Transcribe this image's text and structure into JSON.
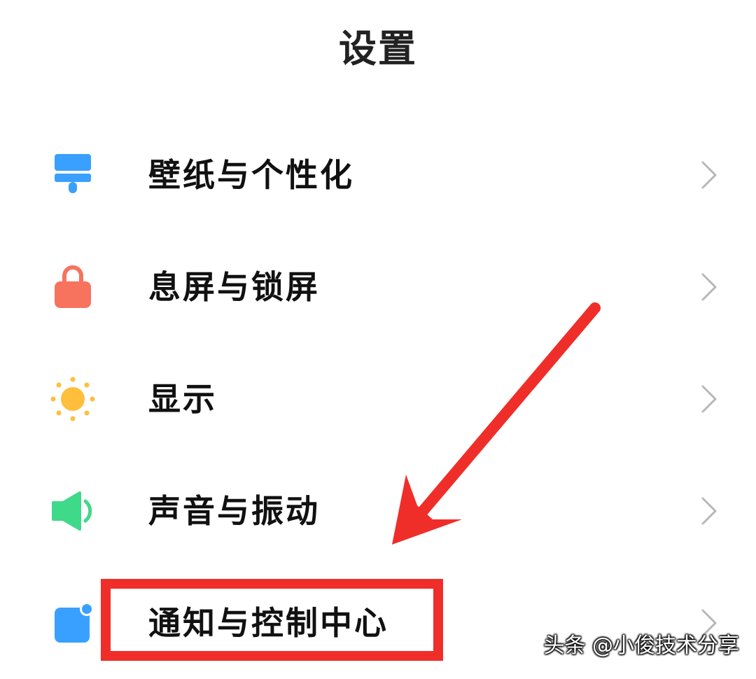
{
  "header": {
    "title": "设置"
  },
  "settings": {
    "items": [
      {
        "label": "壁纸与个性化",
        "icon": "paint-brush-icon",
        "color": "#3aa0ff"
      },
      {
        "label": "息屏与锁屏",
        "icon": "lock-icon",
        "color": "#f7735e"
      },
      {
        "label": "显示",
        "icon": "sun-icon",
        "color": "#ffbe3c"
      },
      {
        "label": "声音与振动",
        "icon": "speaker-icon",
        "color": "#3fd98a"
      },
      {
        "label": "通知与控制中心",
        "icon": "notification-icon",
        "color": "#3aa0ff"
      }
    ]
  },
  "annotation": {
    "color": "#ef2e2a",
    "highlighted_item": "通知与控制中心"
  },
  "watermark": {
    "text": "头条 @小俊技术分享"
  }
}
